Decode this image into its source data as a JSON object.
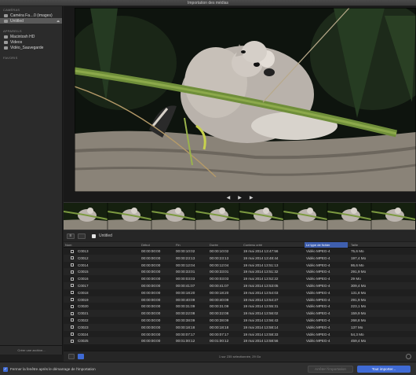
{
  "window": {
    "title": "Importation des médias"
  },
  "sidebar": {
    "sections": [
      {
        "label": "CAMÉRAS",
        "items": [
          {
            "label": "Caméra Fa…0 (images)",
            "icon": "camera-icon",
            "selected": false
          },
          {
            "label": "Untitled",
            "icon": "card-icon",
            "selected": true,
            "eject": "⏏"
          }
        ]
      },
      {
        "label": "APPAREILS",
        "items": [
          {
            "label": "Macintosh HD",
            "icon": "hard-drive-icon",
            "selected": false
          },
          {
            "label": "Videos",
            "icon": "drive-icon",
            "selected": false
          },
          {
            "label": "Vidéo_Sauvegarde",
            "icon": "drive-icon",
            "selected": false
          }
        ]
      },
      {
        "label": "FAVORIS",
        "items": []
      }
    ],
    "footer_label": "Créer une archive..."
  },
  "viewer": {
    "prev_glyph": "◀",
    "play_glyph": "▶",
    "next_glyph": "▶"
  },
  "browser": {
    "view_button_glyph": "≡",
    "volume_label": "Untitled"
  },
  "table": {
    "columns": [
      "Nom",
      "Début",
      "Fin",
      "Durée",
      "Contenu créé",
      "Le type de fichier",
      "Taille"
    ],
    "sorted_column": 5,
    "rows": [
      [
        "C0013",
        "00:00:00:00",
        "00:00:10:02",
        "00:00:10:02",
        "19 mai 2014 13:47:56",
        "Vidéo MPEG-4",
        "75,6 Mo"
      ],
      [
        "C0012",
        "00:00:00:00",
        "00:00:23:13",
        "00:00:23:13",
        "19 mai 2014 13:48:44",
        "Vidéo MPEG-4",
        "197,4 Mo"
      ],
      [
        "C0014",
        "00:00:00:00",
        "00:00:12:04",
        "00:00:12:04",
        "19 mai 2014 13:51:13",
        "Vidéo MPEG-4",
        "86,6 Mo"
      ],
      [
        "C0015",
        "00:00:00:00",
        "00:00:33:01",
        "00:00:33:01",
        "19 mai 2014 13:51:32",
        "Vidéo MPEG-4",
        "291,9 Mo"
      ],
      [
        "C0016",
        "00:00:00:00",
        "00:00:03:03",
        "00:00:03:03",
        "19 mai 2014 13:52:22",
        "Vidéo MPEG-4",
        "29 Mo"
      ],
      [
        "C0017",
        "00:00:00:00",
        "00:00:41:07",
        "00:00:41:07",
        "19 mai 2014 13:53:05",
        "Vidéo MPEG-4",
        "309,4 Mo"
      ],
      [
        "C0018",
        "00:00:00:00",
        "00:00:18:20",
        "00:00:18:20",
        "19 mai 2014 13:54:03",
        "Vidéo MPEG-4",
        "131,8 Mo"
      ],
      [
        "C0019",
        "00:00:00:00",
        "00:00:40:09",
        "00:00:40:09",
        "19 mai 2014 13:54:27",
        "Vidéo MPEG-4",
        "291,9 Mo"
      ],
      [
        "C0020",
        "00:00:00:00",
        "00:00:31:09",
        "00:00:31:09",
        "19 mai 2014 13:55:31",
        "Vidéo MPEG-4",
        "223,1 Mo"
      ],
      [
        "C0021",
        "00:00:00:00",
        "00:00:22:08",
        "00:00:22:08",
        "19 mai 2014 13:56:02",
        "Vidéo MPEG-4",
        "159,9 Mo"
      ],
      [
        "C0022",
        "00:00:00:00",
        "00:00:38:09",
        "00:00:38:09",
        "19 mai 2014 13:56:43",
        "Vidéo MPEG-4",
        "268,8 Mo"
      ],
      [
        "C0023",
        "00:00:00:00",
        "00:00:18:18",
        "00:00:18:18",
        "19 mai 2014 13:58:14",
        "Vidéo MPEG-4",
        "137 Mo"
      ],
      [
        "C0024",
        "00:00:00:00",
        "00:00:07:17",
        "00:00:07:17",
        "19 mai 2014 13:58:33",
        "Vidéo MPEG-4",
        "54,3 Mo"
      ],
      [
        "C0025",
        "00:00:00:00",
        "00:01:00:12",
        "00:01:00:12",
        "19 mai 2014 13:58:56",
        "Vidéo MPEG-4",
        "459,4 Mo"
      ]
    ]
  },
  "status": {
    "info": "1 sur 235 sélectionnée, 29 Go"
  },
  "footer": {
    "checkbox_label": "Fermer la fenêtre après le démarrage de l'importation",
    "checkbox_checked": true,
    "secondary_button": "Arrêter l'importation",
    "primary_button": "Tout importer..."
  },
  "colors": {
    "accent": "#3f6ad4"
  }
}
